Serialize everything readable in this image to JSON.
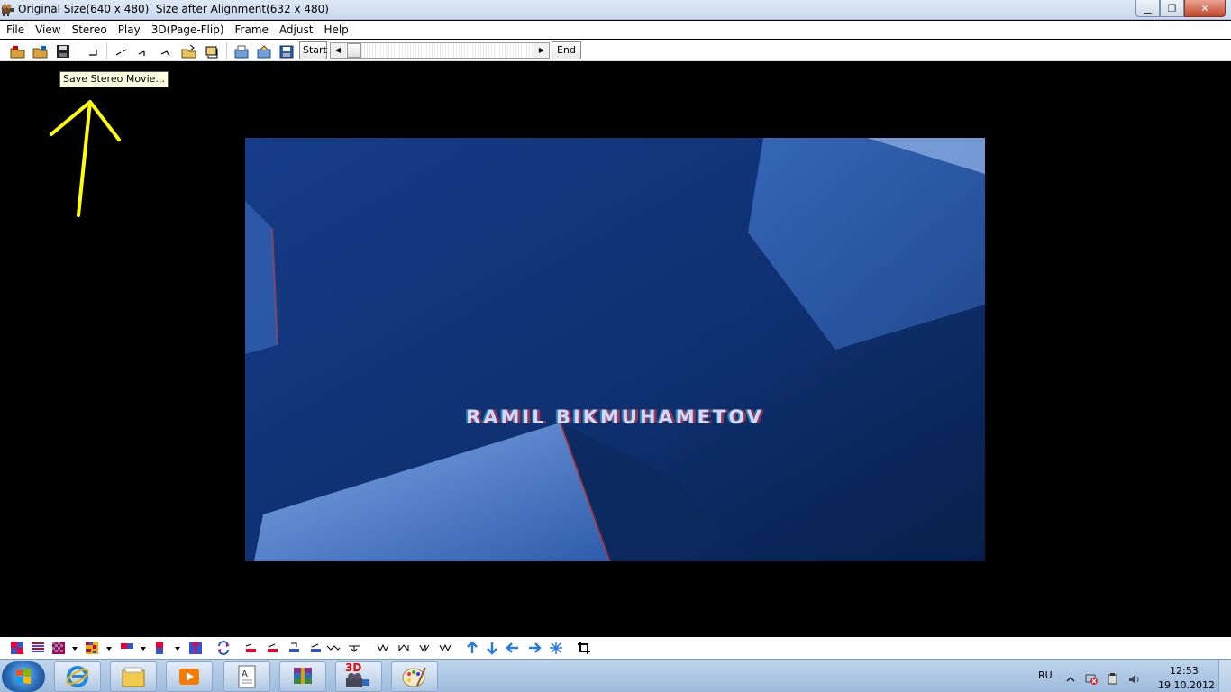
{
  "window": {
    "title": "Original Size(640 x 480)  Size after Alignment(632 x 480)",
    "controls": [
      "minimize",
      "maximize",
      "close"
    ]
  },
  "menu": [
    "File",
    "View",
    "Stereo",
    "Play",
    "3D(Page-Flip)",
    "Frame",
    "Adjust",
    "Help"
  ],
  "toolbar": {
    "start_label": "Start",
    "end_label": "End",
    "icons": [
      "open-left-icon",
      "open-right-icon",
      "save-stereo-icon",
      "align-icon",
      "swap-icon",
      "flip-icon",
      "rotate-icon",
      "crop-icon",
      "load-icon",
      "export-icon",
      "save-disk-icon"
    ]
  },
  "tooltip": {
    "text": "Save Stereo Movie..."
  },
  "video": {
    "caption": "RAMIL BIKMUHAMETOV"
  },
  "bottom_toolbar": {
    "icons": [
      "anaglyph-rc-icon",
      "interlaced-icon",
      "checkerboard-icon",
      "dropdown-icon",
      "mosaic-icon",
      "dropdown-icon",
      "side-by-side-icon",
      "dropdown-icon",
      "over-under-icon",
      "dropdown-icon",
      "split-icon",
      "swap-eyes-icon",
      "align-1-icon",
      "align-2-icon",
      "align-3-icon",
      "align-4-icon",
      "align-5-icon",
      "align-6-icon",
      "wave-1-icon",
      "wave-2-icon",
      "wave-3-icon",
      "wave-4-icon",
      "arrow-up-icon",
      "arrow-down-icon",
      "arrow-left-icon",
      "arrow-right-icon",
      "center-icon",
      "crop-icon"
    ]
  },
  "taskbar": {
    "apps": [
      "internet-explorer-icon",
      "explorer-icon",
      "media-player-icon",
      "document-icon",
      "winrar-icon",
      "stereo-movie-maker-icon",
      "paint-icon"
    ],
    "stereo_app_badge": "3D",
    "language": "RU",
    "time": "12:53",
    "date": "19.10.2012"
  },
  "colors": {
    "highlight_arrow": "#ffff00",
    "video_blue": "#0d2b66",
    "taskbar": "#b5cde8"
  }
}
